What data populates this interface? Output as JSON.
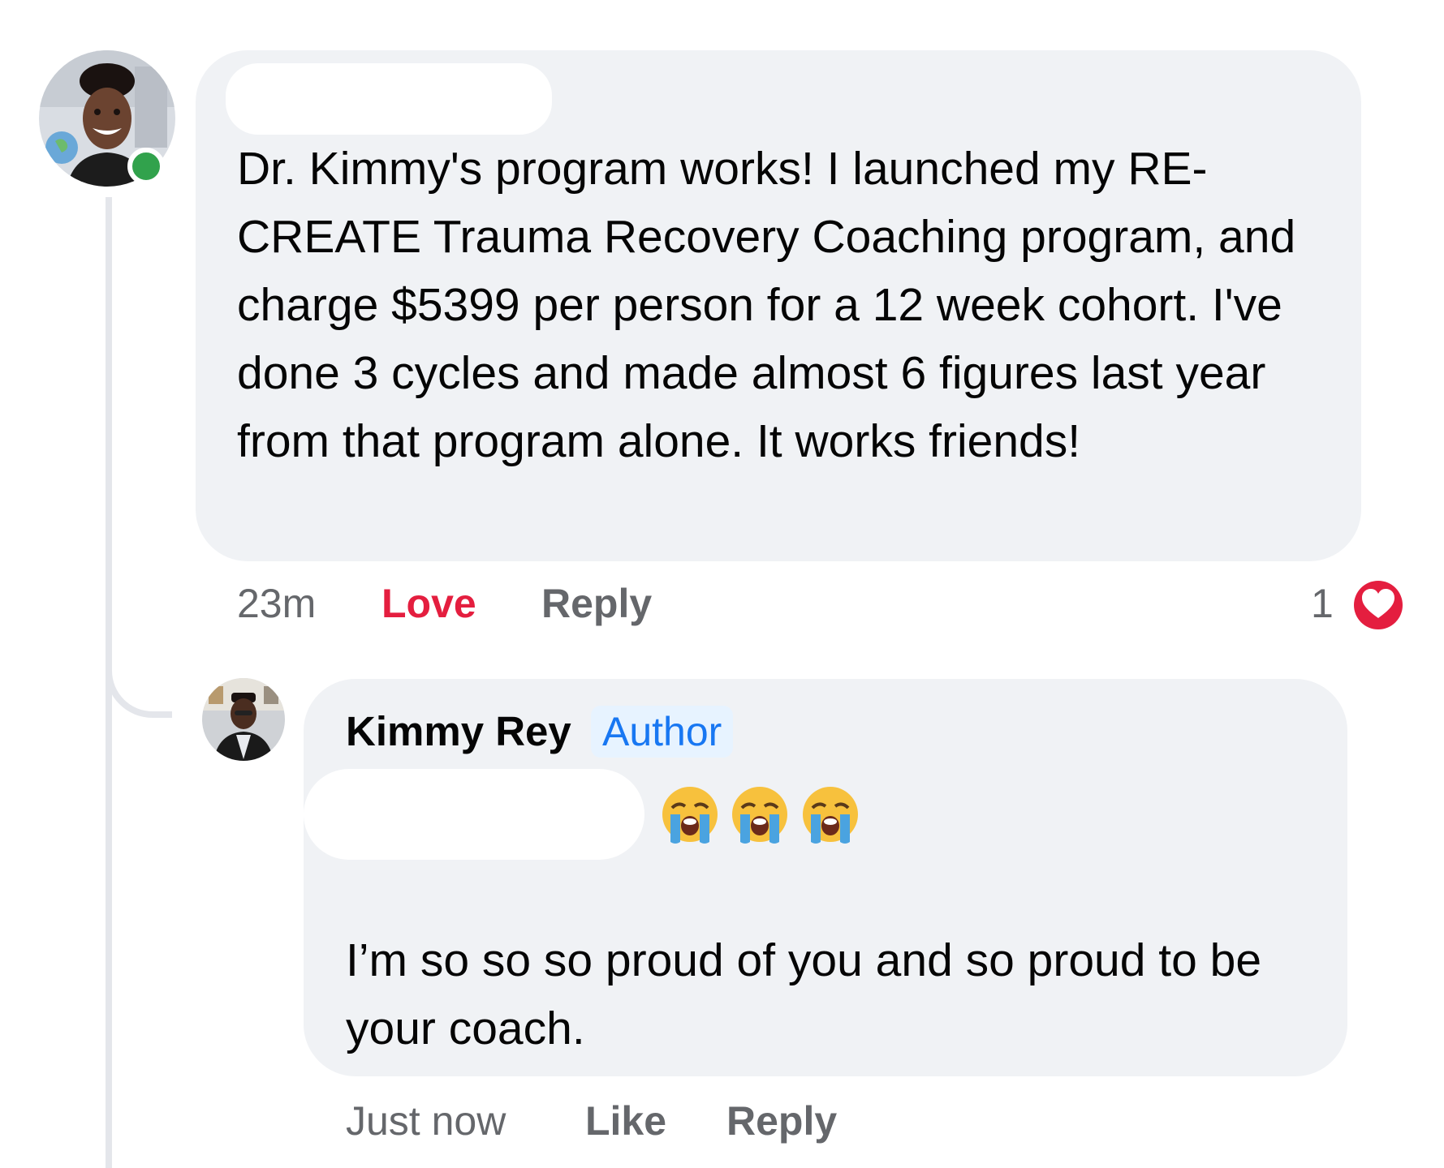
{
  "comment": {
    "text": "Dr. Kimmy's program works! I launched my RE-CREATE Trauma Recovery Coaching program, and charge $5399 per person for a 12 week cohort. I've done 3 cycles and made almost 6 figures last year from that program alone. It works friends!",
    "time": "23m",
    "love_label": "Love",
    "reply_label": "Reply",
    "reaction_count": "1",
    "reaction_icon": "heart-icon",
    "online": true
  },
  "reply": {
    "author_name": "Kimmy Rey",
    "author_badge": "Author",
    "emojis": [
      "😭",
      "😭",
      "😭"
    ],
    "text": "I’m so so so proud of you and so proud to be your coach.",
    "time": "Just now",
    "like_label": "Like",
    "reply_label": "Reply"
  },
  "colors": {
    "bubble": "#f0f2f5",
    "meta_text": "#65676b",
    "love": "#e41e3f",
    "badge_text": "#1877f2",
    "badge_bg": "#e7f3ff",
    "online": "#31a24c"
  }
}
